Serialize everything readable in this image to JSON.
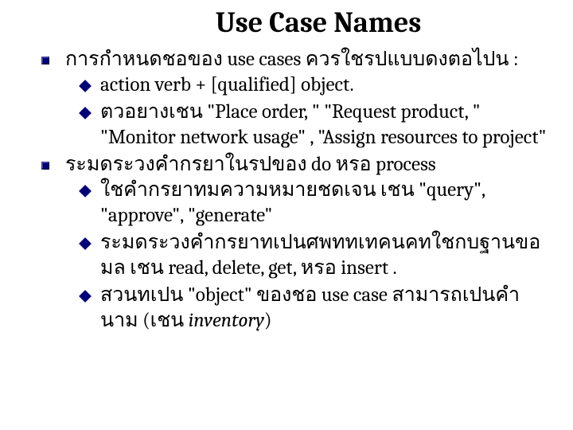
{
  "title": "Use Case Names",
  "bullets": [
    {
      "text": "การกำหนดชอของ use cases ควรใชรปแบบดงตอไปน :",
      "sub": [
        {
          "text": "action verb + [qualified] object."
        },
        {
          "text": "ตวอยางเชน \"Place order, \" \"Request product, \" \"Monitor network usage\" , \"Assign resources to project\""
        }
      ]
    },
    {
      "text": "ระมดระวงคำกรยาในรปของ do หรอ process",
      "sub": [
        {
          "text": "ใชคำกรยาทมความหมายชดเจน เชน \"query\", \"approve\", \"generate\""
        },
        {
          "text": "ระมดระวงคำกรยาทเปนศพททเทคนคทใชกบฐานขอมล เชน read, delete, get, หรอ insert ."
        },
        {
          "text_html": "สวนทเปน \"object\" ของชอ use case สามารถเปนคำนาม (เชน <span class=\"italic\">inventory</span>)"
        }
      ]
    }
  ]
}
